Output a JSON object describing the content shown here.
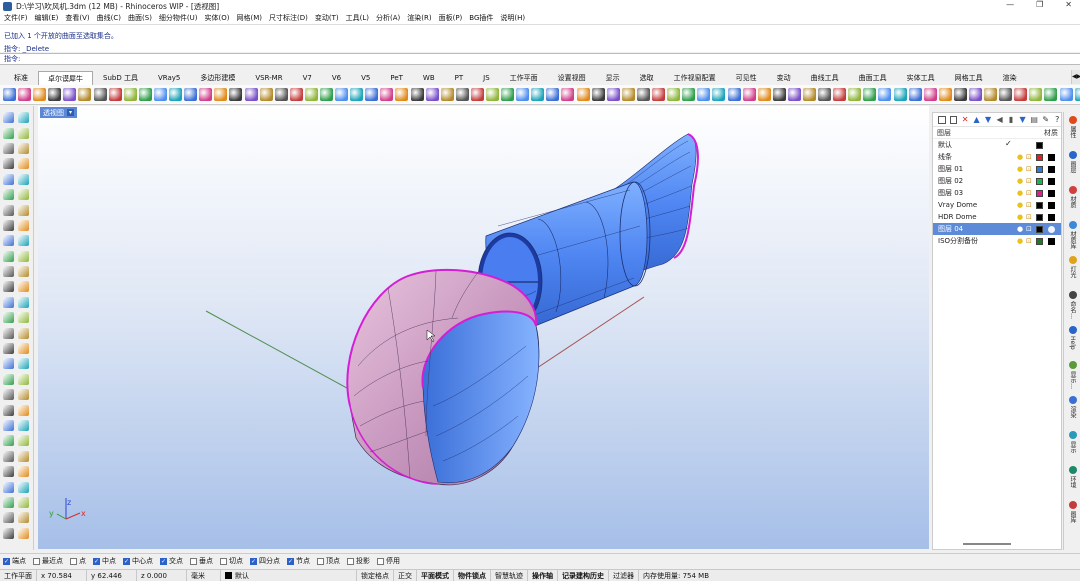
{
  "window": {
    "title": "D:\\学习\\吹风机.3dm (12 MB) - Rhinoceros WIP - [透视图]",
    "min": "—",
    "restore": "❐",
    "close": "✕"
  },
  "menu": [
    "文件(F)",
    "编辑(E)",
    "查看(V)",
    "曲线(C)",
    "曲面(S)",
    "细分物件(U)",
    "实体(O)",
    "网格(M)",
    "尺寸标注(D)",
    "变动(T)",
    "工具(L)",
    "分析(A)",
    "渲染(R)",
    "面板(P)",
    "BG插件",
    "说明(H)"
  ],
  "command_history": [
    "已加入 1 个开放的曲面至选取集合。",
    "指令: _Delete"
  ],
  "command_prompt": "指令:",
  "tabs": [
    "标准",
    "卓尔谟犀牛",
    "SubD 工具",
    "VRay5",
    "多边形建模",
    "VSR-MR",
    "V7",
    "V6",
    "V5",
    "PeT",
    "WB",
    "PT",
    "JS",
    "工作平面",
    "设置视图",
    "显示",
    "选取",
    "工作视窗配置",
    "可见性",
    "变动",
    "曲线工具",
    "曲面工具",
    "实体工具",
    "网格工具",
    "渲染"
  ],
  "active_tab_index": 1,
  "tab_scroll": "◀▶",
  "viewport": {
    "label": "透视图",
    "label_caret": "▾",
    "axis_x": "x",
    "axis_y": "y",
    "axis_z": "z"
  },
  "layers_panel": {
    "header_layers": "图层",
    "header_material": "材质",
    "layers": [
      {
        "name": "默认",
        "current": true,
        "color": "#000000"
      },
      {
        "name": "线条",
        "current": false,
        "color": "#e02020"
      },
      {
        "name": "图层 01",
        "current": false,
        "color": "#2f7bd8"
      },
      {
        "name": "图层 02",
        "current": false,
        "color": "#22b24a"
      },
      {
        "name": "图层 03",
        "current": false,
        "color": "#e0208a"
      },
      {
        "name": "Vray Dome",
        "current": false,
        "color": "#000000"
      },
      {
        "name": "HDR Dome",
        "current": false,
        "color": "#000000"
      },
      {
        "name": "图层 04",
        "current": false,
        "color": "#000000",
        "selected": true
      },
      {
        "name": "ISO分割备份",
        "current": false,
        "color": "#1e7a2a"
      }
    ],
    "current_mark": "✓"
  },
  "right_tabs": [
    "属性",
    "图层",
    "材质",
    "材质库",
    "灯光",
    "命名…",
    "Help",
    "显示…",
    "渲染",
    "显示",
    "环境",
    "图库"
  ],
  "osnaps": [
    {
      "label": "端点",
      "on": true
    },
    {
      "label": "最近点",
      "on": false
    },
    {
      "label": "点",
      "on": false
    },
    {
      "label": "中点",
      "on": true
    },
    {
      "label": "中心点",
      "on": true
    },
    {
      "label": "交点",
      "on": true
    },
    {
      "label": "垂点",
      "on": false
    },
    {
      "label": "切点",
      "on": false
    },
    {
      "label": "四分点",
      "on": true
    },
    {
      "label": "节点",
      "on": true
    },
    {
      "label": "顶点",
      "on": false
    },
    {
      "label": "投影",
      "on": false
    },
    {
      "label": "停用",
      "on": false
    }
  ],
  "status": {
    "cplane": "工作平面",
    "x": "x 70.584",
    "y": "y 62.446",
    "z": "z 0.000",
    "units": "毫米",
    "layer": "默认",
    "toggles": [
      "锁定格点",
      "正交",
      "平面模式",
      "物件锁点",
      "智慧轨迹",
      "操作轴",
      "记录建构历史",
      "过滤器"
    ],
    "toggles_bold": [
      false,
      false,
      true,
      true,
      false,
      true,
      true,
      false
    ],
    "memory": "内存使用量: 754 MB"
  }
}
